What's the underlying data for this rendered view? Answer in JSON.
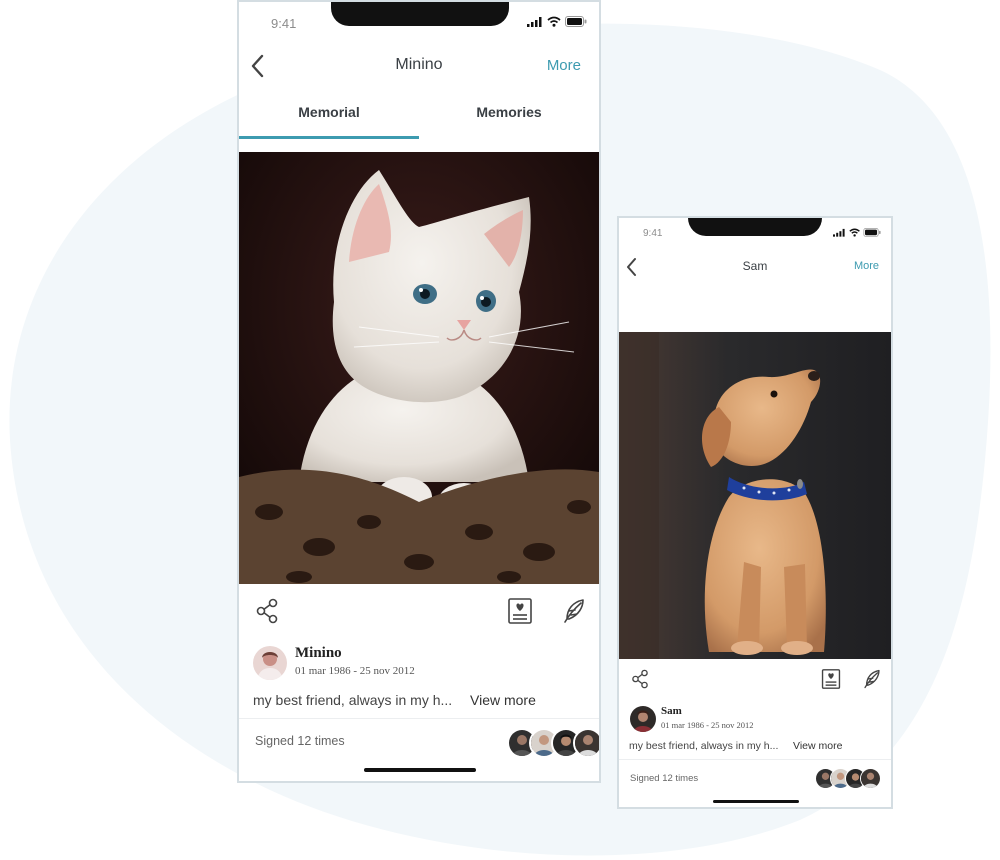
{
  "phones": [
    {
      "status_time": "9:41",
      "header": {
        "back_icon": "chevron-left-icon",
        "title": "Minino",
        "more_label": "More"
      },
      "tabs": [
        {
          "label": "Memorial",
          "active": true
        },
        {
          "label": "Memories",
          "active": false
        }
      ],
      "photo": "white-kitten",
      "actions": {
        "share_icon": "share-icon",
        "memorial_icon": "memorial-card-icon",
        "feather_icon": "feather-icon"
      },
      "profile": {
        "name": "Minino",
        "dates": "01 mar 1986 - 25 nov 2012"
      },
      "description": "my best friend, always in my h...",
      "view_more_label": "View more",
      "signed_text": "Signed 12 times"
    },
    {
      "status_time": "9:41",
      "header": {
        "back_icon": "chevron-left-icon",
        "title": "Sam",
        "more_label": "More"
      },
      "photo": "puppy",
      "actions": {
        "share_icon": "share-icon",
        "memorial_icon": "memorial-card-icon",
        "feather_icon": "feather-icon"
      },
      "profile": {
        "name": "Sam",
        "dates": "01 mar 1986 - 25 nov 2012"
      },
      "description": "my best friend, always in my h...",
      "view_more_label": "View more",
      "signed_text": "Signed 12 times"
    }
  ],
  "colors": {
    "accent": "#3d9bb0",
    "blob": "#f2f7fa",
    "phone_border": "#d4dde2"
  }
}
